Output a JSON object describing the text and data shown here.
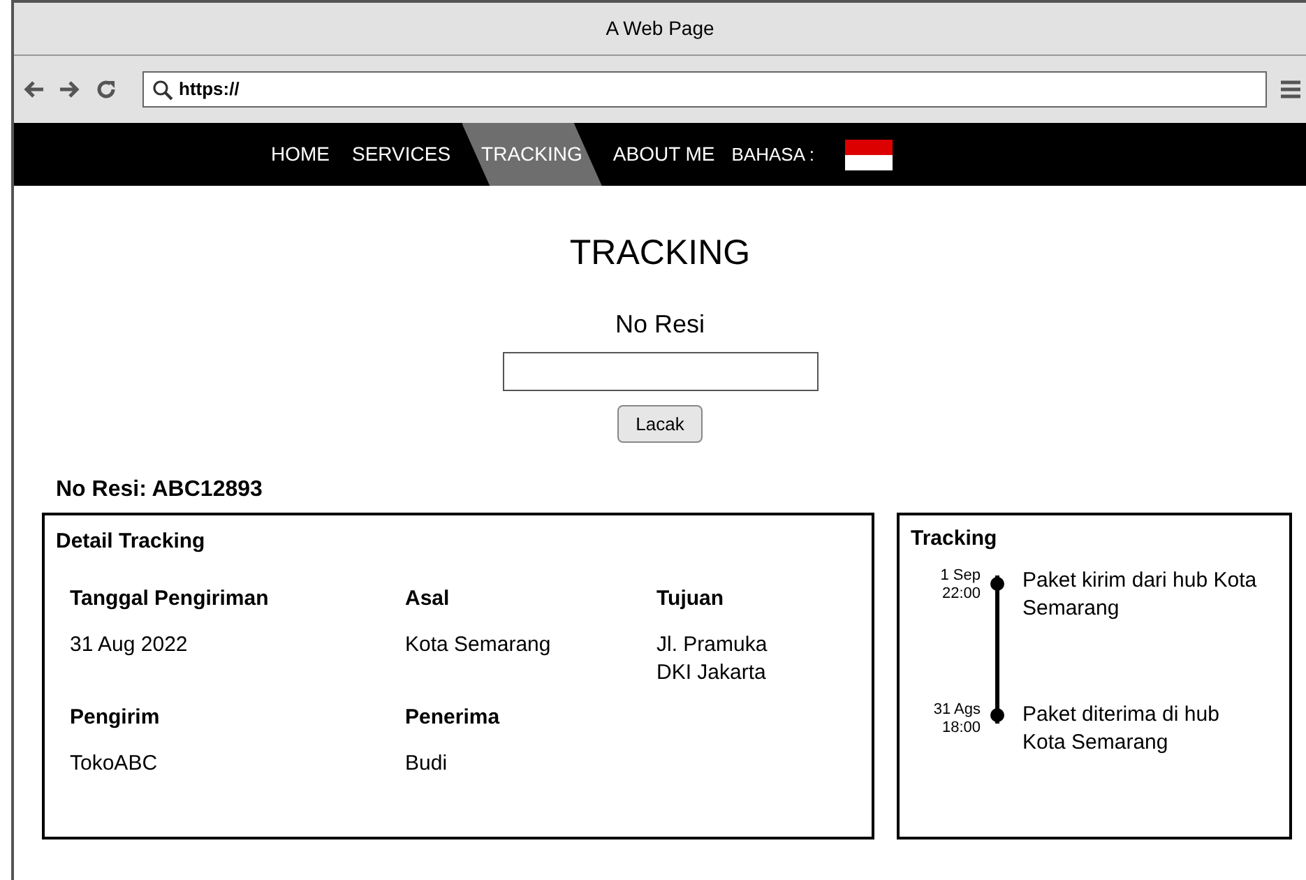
{
  "window": {
    "title": "A Web Page"
  },
  "address_bar": {
    "value": "https://"
  },
  "nav": {
    "items": [
      {
        "label": "HOME",
        "selected": false
      },
      {
        "label": "SERVICES",
        "selected": false
      },
      {
        "label": "TRACKING",
        "selected": true
      },
      {
        "label": "ABOUT ME",
        "selected": false
      }
    ],
    "language_label": "BAHASA :"
  },
  "search": {
    "title": "TRACKING",
    "field_label": "No Resi",
    "button": "Lacak"
  },
  "result": {
    "heading": "No Resi: ABC12893",
    "detail": {
      "title": "Detail Tracking",
      "fields": [
        {
          "label": "Tanggal Pengiriman",
          "value": [
            "31 Aug 2022"
          ]
        },
        {
          "label": "Asal",
          "value": [
            "Kota Semarang"
          ]
        },
        {
          "label": "Tujuan",
          "value": [
            "Jl. Pramuka",
            "DKI Jakarta"
          ]
        },
        {
          "label": "Pengirim",
          "value": [
            "TokoABC"
          ]
        },
        {
          "label": "Penerima",
          "value": [
            "Budi"
          ]
        }
      ]
    },
    "tracking": {
      "title": "Tracking",
      "events": [
        {
          "date": "1 Sep",
          "time": "22:00",
          "text": "Paket kirim dari hub Kota Semarang"
        },
        {
          "date": "31 Ags",
          "time": "18:00",
          "text": "Paket diterima di hub Kota Semarang"
        }
      ]
    }
  }
}
